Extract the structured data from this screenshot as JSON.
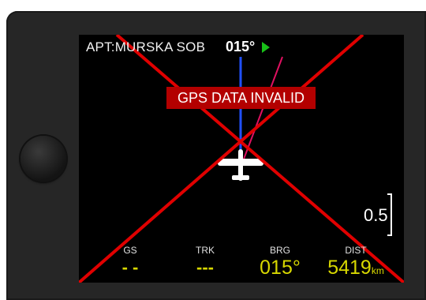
{
  "header": {
    "airport": "APT:MURSKA SOB",
    "heading": "015°"
  },
  "warning": "GPS DATA INVALID",
  "range": "0.5",
  "fields": {
    "gs": {
      "label": "GS",
      "value": "- -"
    },
    "trk": {
      "label": "TRK",
      "value": "---"
    },
    "brg": {
      "label": "BRG",
      "value": "015°"
    },
    "dist": {
      "label": "DIST",
      "value": "5419",
      "unit": "km"
    }
  },
  "colors": {
    "warning_bg": "#b30000",
    "invalid_cross": "#e00000",
    "course_line": "#2050ff",
    "bearing_line": "#e01060",
    "value_text": "#d8d800",
    "heading_arrow": "#18c018"
  },
  "icons": {
    "heading_pointer": "triangle-right",
    "aircraft": "airplane-topdown"
  }
}
